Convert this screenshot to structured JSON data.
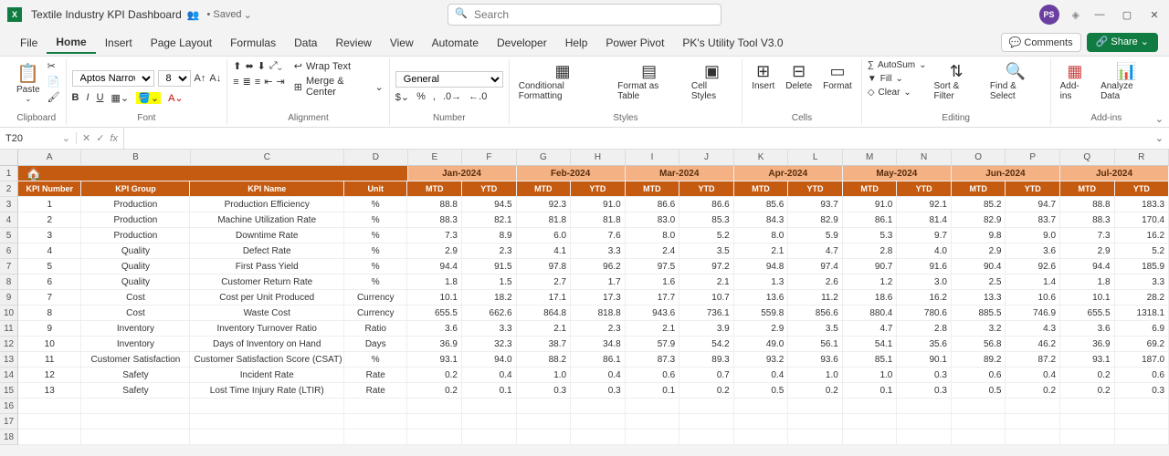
{
  "app": {
    "title": "Textile Industry KPI Dashboard",
    "saved_indicator": "• Saved",
    "search_placeholder": "Search",
    "avatar": "PS"
  },
  "menu": {
    "file": "File",
    "home": "Home",
    "insert": "Insert",
    "page_layout": "Page Layout",
    "formulas": "Formulas",
    "data": "Data",
    "review": "Review",
    "view": "View",
    "automate": "Automate",
    "developer": "Developer",
    "help": "Help",
    "power_pivot": "Power Pivot",
    "utility": "PK's Utility Tool V3.0",
    "comments": "Comments",
    "share": "Share"
  },
  "ribbon": {
    "clipboard": {
      "paste": "Paste",
      "label": "Clipboard"
    },
    "font": {
      "name": "Aptos Narrow",
      "size": "8",
      "label": "Font"
    },
    "alignment": {
      "wrap": "Wrap Text",
      "merge": "Merge & Center",
      "label": "Alignment"
    },
    "number": {
      "format": "General",
      "label": "Number"
    },
    "styles": {
      "cond": "Conditional Formatting",
      "table": "Format as Table",
      "cell": "Cell Styles",
      "label": "Styles"
    },
    "cells": {
      "insert": "Insert",
      "delete": "Delete",
      "format": "Format",
      "label": "Cells"
    },
    "editing": {
      "autosum": "AutoSum",
      "fill": "Fill",
      "clear": "Clear",
      "sort": "Sort & Filter",
      "find": "Find & Select",
      "label": "Editing"
    },
    "addins": {
      "addins": "Add-ins",
      "analyze": "Analyze Data",
      "label": "Add-ins"
    }
  },
  "namebox": "T20",
  "columns": [
    "A",
    "B",
    "C",
    "D",
    "E",
    "F",
    "G",
    "H",
    "I",
    "J",
    "K",
    "L",
    "M",
    "N",
    "O",
    "P",
    "Q",
    "R"
  ],
  "months": [
    "Jan-2024",
    "Feb-2024",
    "Mar-2024",
    "Apr-2024",
    "May-2024",
    "Jun-2024",
    "Jul-2024"
  ],
  "headers": {
    "kpi_num": "KPI Number",
    "kpi_group": "KPI Group",
    "kpi_name": "KPI Name",
    "unit": "Unit",
    "mtd": "MTD",
    "ytd": "YTD"
  },
  "rows": [
    {
      "n": "1",
      "g": "Production",
      "name": "Production Efficiency",
      "u": "%",
      "v": [
        "88.8",
        "94.5",
        "92.3",
        "91.0",
        "86.6",
        "86.6",
        "85.6",
        "93.7",
        "91.0",
        "92.1",
        "85.2",
        "94.7",
        "88.8",
        "183.3"
      ]
    },
    {
      "n": "2",
      "g": "Production",
      "name": "Machine Utilization Rate",
      "u": "%",
      "v": [
        "88.3",
        "82.1",
        "81.8",
        "81.8",
        "83.0",
        "85.3",
        "84.3",
        "82.9",
        "86.1",
        "81.4",
        "82.9",
        "83.7",
        "88.3",
        "170.4"
      ]
    },
    {
      "n": "3",
      "g": "Production",
      "name": "Downtime Rate",
      "u": "%",
      "v": [
        "7.3",
        "8.9",
        "6.0",
        "7.6",
        "8.0",
        "5.2",
        "8.0",
        "5.9",
        "5.3",
        "9.7",
        "9.8",
        "9.0",
        "7.3",
        "16.2"
      ]
    },
    {
      "n": "4",
      "g": "Quality",
      "name": "Defect Rate",
      "u": "%",
      "v": [
        "2.9",
        "2.3",
        "4.1",
        "3.3",
        "2.4",
        "3.5",
        "2.1",
        "4.7",
        "2.8",
        "4.0",
        "2.9",
        "3.6",
        "2.9",
        "5.2"
      ]
    },
    {
      "n": "5",
      "g": "Quality",
      "name": "First Pass Yield",
      "u": "%",
      "v": [
        "94.4",
        "91.5",
        "97.8",
        "96.2",
        "97.5",
        "97.2",
        "94.8",
        "97.4",
        "90.7",
        "91.6",
        "90.4",
        "92.6",
        "94.4",
        "185.9"
      ]
    },
    {
      "n": "6",
      "g": "Quality",
      "name": "Customer Return Rate",
      "u": "%",
      "v": [
        "1.8",
        "1.5",
        "2.7",
        "1.7",
        "1.6",
        "2.1",
        "1.3",
        "2.6",
        "1.2",
        "3.0",
        "2.5",
        "1.4",
        "1.8",
        "3.3"
      ]
    },
    {
      "n": "7",
      "g": "Cost",
      "name": "Cost per Unit Produced",
      "u": "Currency",
      "v": [
        "10.1",
        "18.2",
        "17.1",
        "17.3",
        "17.7",
        "10.7",
        "13.6",
        "11.2",
        "18.6",
        "16.2",
        "13.3",
        "10.6",
        "10.1",
        "28.2"
      ]
    },
    {
      "n": "8",
      "g": "Cost",
      "name": "Waste Cost",
      "u": "Currency",
      "v": [
        "655.5",
        "662.6",
        "864.8",
        "818.8",
        "943.6",
        "736.1",
        "559.8",
        "856.6",
        "880.4",
        "780.6",
        "885.5",
        "746.9",
        "655.5",
        "1318.1"
      ]
    },
    {
      "n": "9",
      "g": "Inventory",
      "name": "Inventory Turnover Ratio",
      "u": "Ratio",
      "v": [
        "3.6",
        "3.3",
        "2.1",
        "2.3",
        "2.1",
        "3.9",
        "2.9",
        "3.5",
        "4.7",
        "2.8",
        "3.2",
        "4.3",
        "3.6",
        "6.9"
      ]
    },
    {
      "n": "10",
      "g": "Inventory",
      "name": "Days of Inventory on Hand",
      "u": "Days",
      "v": [
        "36.9",
        "32.3",
        "38.7",
        "34.8",
        "57.9",
        "54.2",
        "49.0",
        "56.1",
        "54.1",
        "35.6",
        "56.8",
        "46.2",
        "36.9",
        "69.2"
      ]
    },
    {
      "n": "11",
      "g": "Customer Satisfaction",
      "name": "Customer Satisfaction Score (CSAT)",
      "u": "%",
      "v": [
        "93.1",
        "94.0",
        "88.2",
        "86.1",
        "87.3",
        "89.3",
        "93.2",
        "93.6",
        "85.1",
        "90.1",
        "89.2",
        "87.2",
        "93.1",
        "187.0"
      ]
    },
    {
      "n": "12",
      "g": "Safety",
      "name": "Incident Rate",
      "u": "Rate",
      "v": [
        "0.2",
        "0.4",
        "1.0",
        "0.4",
        "0.6",
        "0.7",
        "0.4",
        "1.0",
        "1.0",
        "0.3",
        "0.6",
        "0.4",
        "0.2",
        "0.6"
      ]
    },
    {
      "n": "13",
      "g": "Safety",
      "name": "Lost Time Injury Rate (LTIR)",
      "u": "Rate",
      "v": [
        "0.2",
        "0.1",
        "0.3",
        "0.3",
        "0.1",
        "0.2",
        "0.5",
        "0.2",
        "0.1",
        "0.3",
        "0.5",
        "0.2",
        "0.2",
        "0.3"
      ]
    }
  ]
}
